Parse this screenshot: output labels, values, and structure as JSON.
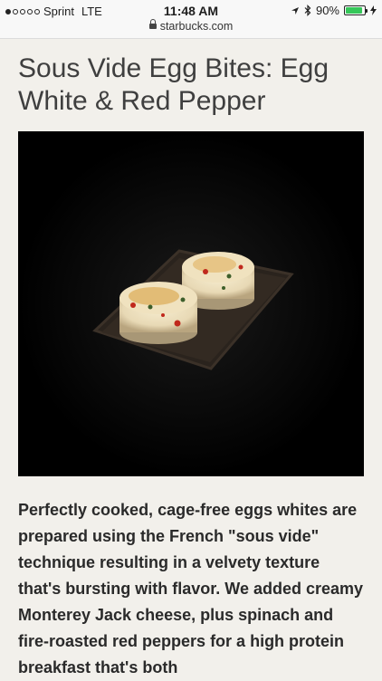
{
  "status_bar": {
    "carrier": "Sprint",
    "network": "LTE",
    "time": "11:48 AM",
    "battery": "90%",
    "battery_level": 0.9,
    "url": "starbucks.com"
  },
  "product": {
    "title": "Sous Vide Egg Bites: Egg White & Red Pepper",
    "description": "Perfectly cooked, cage-free eggs whites are prepared using the French \"sous vide\" technique resulting in a velvety texture that's bursting with flavor. We added creamy Monterey Jack cheese, plus spinach and fire-roasted red peppers for a high protein breakfast that's both"
  }
}
